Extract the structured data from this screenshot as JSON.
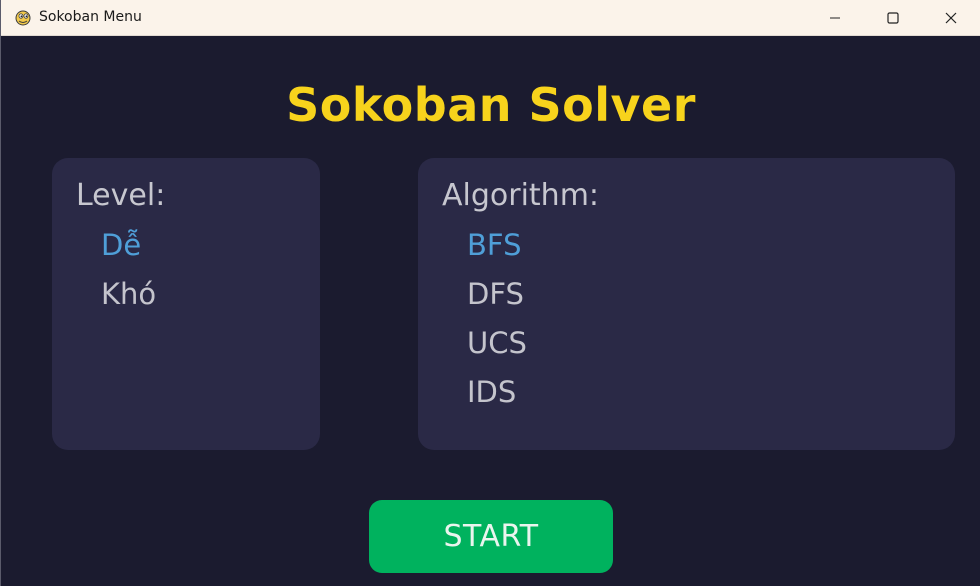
{
  "window": {
    "title": "Sokoban Menu",
    "icon": "pygame-snake-icon"
  },
  "header": {
    "title": "Sokoban Solver"
  },
  "level_panel": {
    "heading": "Level:",
    "options": [
      {
        "label": "Dễ",
        "selected": true
      },
      {
        "label": "Khó",
        "selected": false
      }
    ]
  },
  "algorithm_panel": {
    "heading": "Algorithm:",
    "options": [
      {
        "label": "BFS",
        "selected": true
      },
      {
        "label": "DFS",
        "selected": false
      },
      {
        "label": "UCS",
        "selected": false
      },
      {
        "label": "IDS",
        "selected": false
      }
    ]
  },
  "actions": {
    "start_label": "START"
  },
  "colors": {
    "background": "#1b1b2f",
    "panel": "#2a2946",
    "title": "#f7d31c",
    "selected": "#4f9fd8",
    "unselected": "#c4c4cc",
    "start_button": "#00b25e"
  }
}
